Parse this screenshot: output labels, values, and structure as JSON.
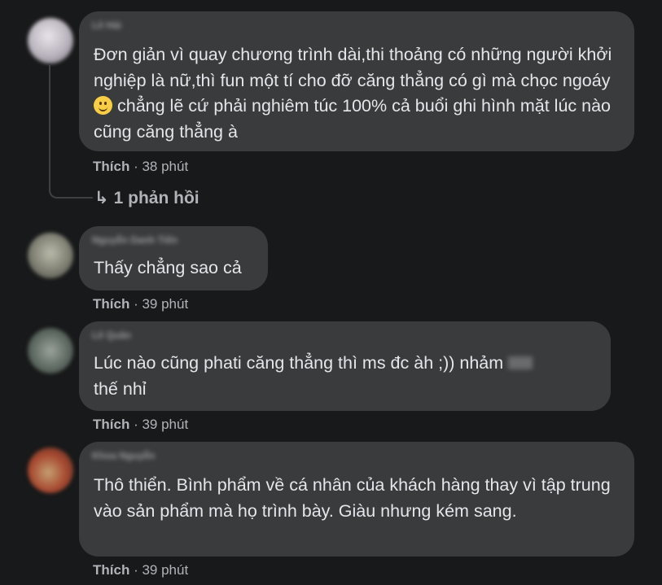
{
  "comments": [
    {
      "name": "Lê Hải",
      "text": "Đơn giản vì quay chương trình dài,thi thoảng có những người khởi nghiệp là nữ,thì fun một tí cho đỡ căng thẳng có gì mà chọc ngoáy",
      "text_after_emoji": "chẳng lẽ cứ phải nghiêm túc 100% cả buổi ghi hình mặt lúc nào cũng căng thẳng à",
      "like": "Thích",
      "time": "· 38 phút",
      "avatar_color": "#c9c6cc"
    },
    {
      "name": "Nguyễn Danh Tiến",
      "text": "Thấy chẳng sao cả",
      "like": "Thích",
      "time": "· 39 phút",
      "avatar_color": "#8d8f84"
    },
    {
      "name": "Lê Quân",
      "text": "Lúc nào cũng phati căng thẳng thì ms đc àh ;)) nhảm",
      "text_tail": "thế nhỉ",
      "like": "Thích",
      "time": "· 39 phút",
      "avatar_color": "#6f7a72"
    },
    {
      "name": "Khoa Nguyễn",
      "text": "Thô thiển. Bình phẩm về cá nhân của khách hàng thay vì tập trung vào sản phẩm mà họ trình bày. Giàu nhưng kém sang.",
      "like": "Thích",
      "time": "· 39 phút",
      "avatar_color": "#a84a32"
    }
  ],
  "reply_link": {
    "arrow": "↳",
    "label": "1 phản hồi"
  },
  "icons": {
    "emoji": "slightly-smiling-face-icon",
    "reply_arrow": "reply-arrow-icon"
  }
}
